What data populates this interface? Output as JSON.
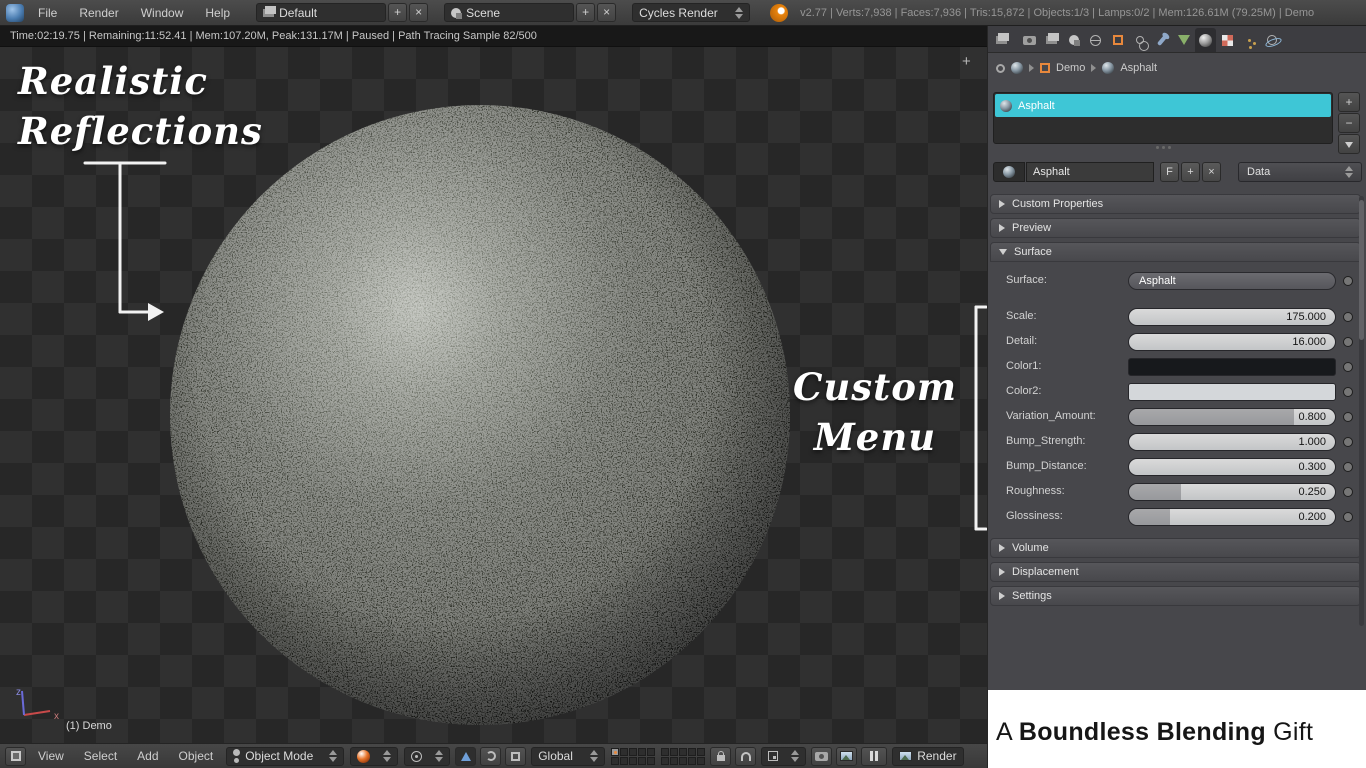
{
  "colors": {
    "accent_cyan": "#3EC6D6",
    "blender_orange": "#E8830C"
  },
  "icons": {
    "add": "+",
    "remove": "−",
    "close": "×",
    "fake_user": "F",
    "dropdown": "css-triangle-down",
    "panel_collapsed": "css-triangle-right",
    "panel_expanded": "css-triangle-down",
    "breadcrumb_separator": "css-triangle-right",
    "region_expand": "+",
    "material_sphere": "css-sphere",
    "object_cube": "css-orange-cube"
  },
  "topbar": {
    "menus": [
      "File",
      "Render",
      "Window",
      "Help"
    ],
    "layout_name": "Default",
    "scene_name": "Scene",
    "engine_name": "Cycles Render",
    "stats": "v2.77 | Verts:7,938 | Faces:7,936 | Tris:15,872 | Objects:1/3 | Lamps:0/2 | Mem:126.61M (79.25M) | Demo"
  },
  "render_status": "Time:02:19.75 | Remaining:11:52.41 | Mem:107.20M, Peak:131.17M | Paused | Path Tracing Sample 82/500",
  "viewport": {
    "annotation_reflections_line1": "Realistic",
    "annotation_reflections_line2": "Reflections",
    "annotation_menu_line1": "Custom",
    "annotation_menu_line2": "Menu",
    "object_info": "(1) Demo",
    "axis_x_label": "x",
    "axis_z_label": "z"
  },
  "toolbar": {
    "menus": [
      "View",
      "Select",
      "Add",
      "Object"
    ],
    "mode": "Object Mode",
    "orientation": "Global",
    "render_label": "Render"
  },
  "properties": {
    "breadcrumb": {
      "scene": "Demo",
      "item": "Asphalt"
    },
    "slots": {
      "selected": "Asphalt"
    },
    "datablock": {
      "name": "Asphalt",
      "fake_user": "F",
      "source": "Data"
    },
    "panels": {
      "custom_properties": "Custom Properties",
      "preview": "Preview",
      "surface": "Surface",
      "volume": "Volume",
      "displacement": "Displacement",
      "settings": "Settings"
    },
    "surface": {
      "menu_label": "Surface:",
      "menu_value": "Asphalt",
      "rows": [
        {
          "label": "Scale:",
          "value": "175.000",
          "fill": 0
        },
        {
          "label": "Detail:",
          "value": "16.000",
          "fill": 0
        },
        {
          "label": "Color1:",
          "swatch": "#17191C"
        },
        {
          "label": "Color2:",
          "swatch": "#D4D7DA"
        },
        {
          "label": "Variation_Amount:",
          "value": "0.800",
          "fill": 0.8
        },
        {
          "label": "Bump_Strength:",
          "value": "1.000",
          "fill": 0
        },
        {
          "label": "Bump_Distance:",
          "value": "0.300",
          "fill": 0
        },
        {
          "label": "Roughness:",
          "value": "0.250",
          "fill": 0.25
        },
        {
          "label": "Glossiness:",
          "value": "0.200",
          "fill": 0.2
        }
      ]
    },
    "brand": {
      "prefix": "A ",
      "bold": "Boundless Blending",
      "suffix": " Gift"
    }
  }
}
